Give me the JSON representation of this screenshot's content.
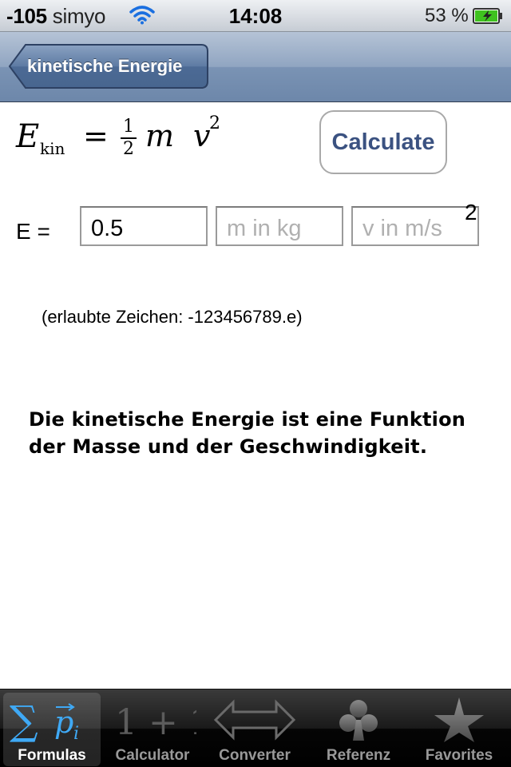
{
  "status_bar": {
    "signal": "-105",
    "carrier": "simyo",
    "time": "14:08",
    "battery": "53 %"
  },
  "nav": {
    "back_label": "kinetische Energie"
  },
  "formula": {
    "E": "E",
    "subscript": "kin",
    "equals": "=",
    "numerator": "1",
    "denominator": "2",
    "m": "m",
    "v": "v",
    "exponent": "2"
  },
  "calculate_button": "Calculate",
  "inputs": {
    "label": "E =",
    "energy_value": "0.5",
    "mass_placeholder": "m in kg",
    "velocity_placeholder": "v in m/s",
    "velocity_exponent": "2"
  },
  "allowed_chars": "(erlaubte Zeichen: -123456789.e)",
  "description": "Die kinetische Energie ist eine Funktion der Masse und der Geschwindigkeit.",
  "tabs": [
    {
      "label": "Formulas",
      "icon": "sum-vector-icon",
      "active": true
    },
    {
      "label": "Calculator",
      "icon": "one-plus-one-icon",
      "active": false
    },
    {
      "label": "Converter",
      "icon": "double-arrow-icon",
      "active": false
    },
    {
      "label": "Referenz",
      "icon": "club-icon",
      "active": false
    },
    {
      "label": "Favorites",
      "icon": "star-icon",
      "active": false
    }
  ],
  "colors": {
    "nav_bar": "#7a93b4",
    "button_text": "#3b5281",
    "tab_active_icon": "#3fa9f5",
    "battery": "#3fc21f"
  }
}
